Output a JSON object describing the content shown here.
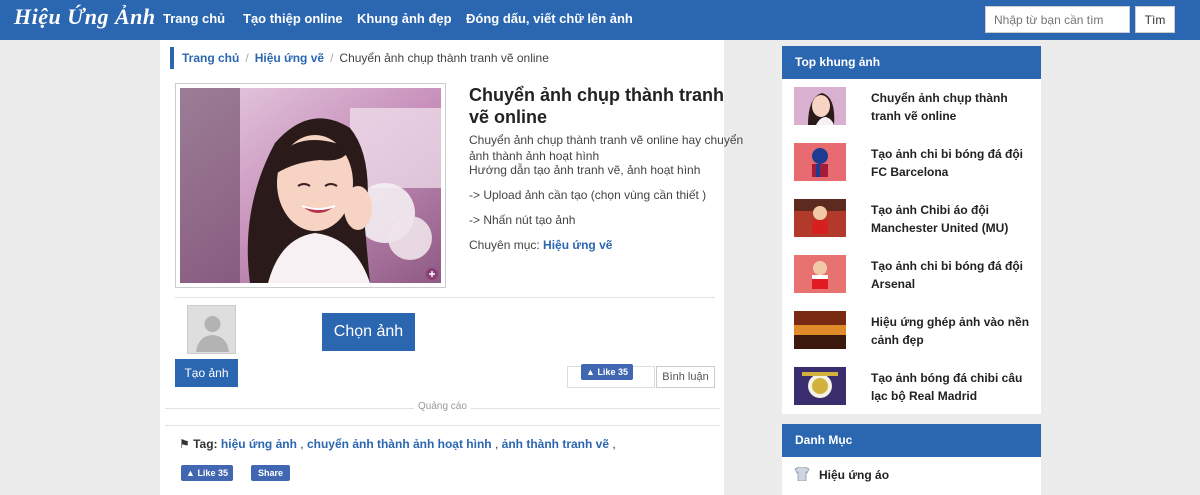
{
  "header": {
    "logo": "Hiệu Ứng Ảnh",
    "nav": [
      "Trang chủ",
      "Tạo thiệp online",
      "Khung ảnh đẹp",
      "Đóng dấu, viết chữ lên ảnh"
    ],
    "search_placeholder": "Nhập từ bạn cần tìm",
    "search_button": "Tìm"
  },
  "breadcrumb": {
    "home": "Trang chủ",
    "section": "Hiệu ứng vẽ",
    "current": "Chuyển ảnh chụp thành tranh vẽ online"
  },
  "effect": {
    "title": "Chuyển ảnh chụp thành tranh vẽ online",
    "description": "Chuyển ảnh chụp thành tranh vẽ online hay chuyển ảnh thành ảnh hoạt hình",
    "guide": "Hướng dẫn tạo ảnh tranh vẽ, ảnh hoạt hình",
    "step1": "-> Upload ảnh cần tạo (chọn vùng cần thiết )",
    "step2": "-> Nhấn nút tạo ảnh",
    "category_label": "Chuyên mục:",
    "category_link": "Hiệu ứng vẽ"
  },
  "actions": {
    "choose_photo": "Chọn ảnh",
    "create": "Tạo ảnh",
    "like_label": "Like 35",
    "comment_tab": "Bình luận",
    "ad_label": "Quảng cáo"
  },
  "tags": {
    "label": "Tag:",
    "items": [
      "hiệu ứng ảnh",
      "chuyển ảnh thành ảnh hoạt hình",
      "ảnh thành tranh vẽ"
    ]
  },
  "social": {
    "like_label": "Like 35",
    "share_label": "Share"
  },
  "sidebar": {
    "top_title": "Top khung ảnh",
    "items": [
      {
        "label": "Chuyển ảnh chụp thành tranh vẽ online",
        "icon": "anime-girl-thumb"
      },
      {
        "label": "Tạo ảnh chi bi bóng đá đội FC Barcelona",
        "icon": "barcelona-chibi-thumb"
      },
      {
        "label": "Tạo ảnh Chibi áo đội Manchester United (MU)",
        "icon": "mu-chibi-thumb"
      },
      {
        "label": "Tạo ảnh chi bi bóng đá đội Arsenal",
        "icon": "arsenal-chibi-thumb"
      },
      {
        "label": "Hiệu ứng ghép ảnh vào nền cảnh đẹp",
        "icon": "sunset-scene-thumb"
      },
      {
        "label": "Tạo ảnh bóng đá chibi câu lạc bộ Real Madrid",
        "icon": "real-madrid-thumb"
      }
    ],
    "category_title": "Danh Mục",
    "categories": [
      {
        "label": "Hiệu ứng áo",
        "icon": "shirt-icon"
      }
    ]
  },
  "colors": {
    "brand": "#2b66b1",
    "facebook": "#4267b2"
  }
}
